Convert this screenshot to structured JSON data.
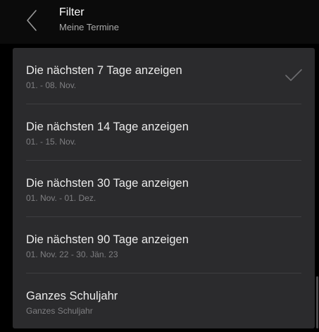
{
  "header": {
    "title": "Filter",
    "subtitle": "Meine Termine"
  },
  "icons": {
    "back": "chevron-left-icon",
    "selected": "checkmark-icon"
  },
  "colors": {
    "background": "#000000",
    "sheet": "#2b2b2d",
    "primary_text": "#ececec",
    "secondary_text": "#7f7f82",
    "check": "#6d6d70"
  },
  "options": [
    {
      "label": "Die nächsten 7 Tage anzeigen",
      "sublabel": "01. - 08. Nov.",
      "selected": true
    },
    {
      "label": "Die nächsten 14 Tage anzeigen",
      "sublabel": "01. - 15. Nov.",
      "selected": false
    },
    {
      "label": "Die nächsten 30 Tage anzeigen",
      "sublabel": "01. Nov. - 01. Dez.",
      "selected": false
    },
    {
      "label": "Die nächsten 90 Tage anzeigen",
      "sublabel": "01. Nov. 22 - 30. Jän. 23",
      "selected": false
    },
    {
      "label": "Ganzes Schuljahr",
      "sublabel": "Ganzes Schuljahr",
      "selected": false
    }
  ]
}
